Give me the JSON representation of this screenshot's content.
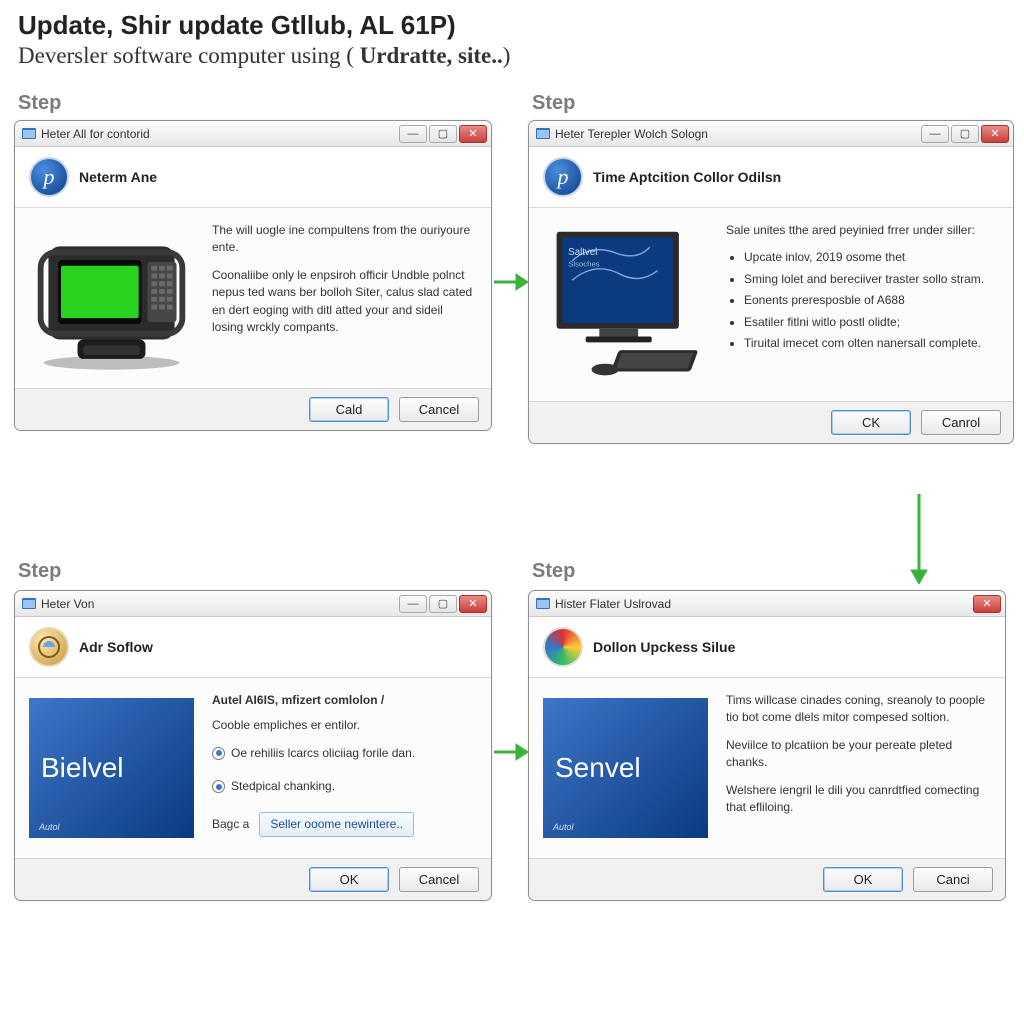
{
  "page": {
    "headline1": "Update, Shir update Gtllub, AL 61P)",
    "headline2_pre": "Deversler software computer using ( ",
    "headline2_bold": "Urdratte, site..",
    "headline2_post": ")"
  },
  "step_label": "Step",
  "buttons": {
    "ok": "OK",
    "cancel": "Cancel",
    "cald": "Cald",
    "ck": "CK",
    "canci": "Canci",
    "canrol": "Canrol"
  },
  "d1": {
    "titlebar": "Heter All for contorid",
    "header": "Neterm Ane",
    "p1": "The will uogle ine compultens from the ouriyoure ente.",
    "p2": "Coonaliibe only le enpsiroh officir Undble polnct nepus ted wans ber bolloh Siter, calus slad cated en dert eoging with ditl atted your and sideil losing wrckly compants."
  },
  "d2": {
    "titlebar": "Heter Terepler Wolch Sologn",
    "header": "Time Aptcition Collor Odilsn",
    "intro": "Sale unites tthe ared peyinied frrer under siller:",
    "bullets": [
      "Upcate inlov, 2019 osome thet",
      "Sming lolet and bereciiver traster sollo stram.",
      "Eonents preresposble of A688",
      "Esatiler fitlni witlo postl olidte;",
      "Tiruital imecet com olten nanersall complete."
    ],
    "monitor_label1": "Saltvel",
    "monitor_label2": "Slsoches"
  },
  "d3": {
    "titlebar": "Heter Von",
    "header": "Adr Soflow",
    "strong": "Autel AI6IS, mfizert comlolon /",
    "subtitle": "Cooble empliches er entilor.",
    "radio1": "Oe rehiliis lcarcs oliciiag forile dan.",
    "radio2": "Stedpical chanking.",
    "bagc_label": "Bagc a",
    "link_btn": "Seller ooome newintere..",
    "logo_text": "Bielvel",
    "logo_sub": "Autol"
  },
  "d4": {
    "titlebar": "Hister Flater Uslrovad",
    "header": "Dollon Upckess Silue",
    "p1": "Tims willcase cinades coning, sreanoly to poople tio bot come dlels mitor compesed soltion.",
    "p2": "Neviilce to plcatiion be your pereate pleted chanks.",
    "p3": "Welshere iengril le dili you canrdtfied comecting that efliloing.",
    "logo_text": "Senvel",
    "logo_sub": "Autol"
  }
}
